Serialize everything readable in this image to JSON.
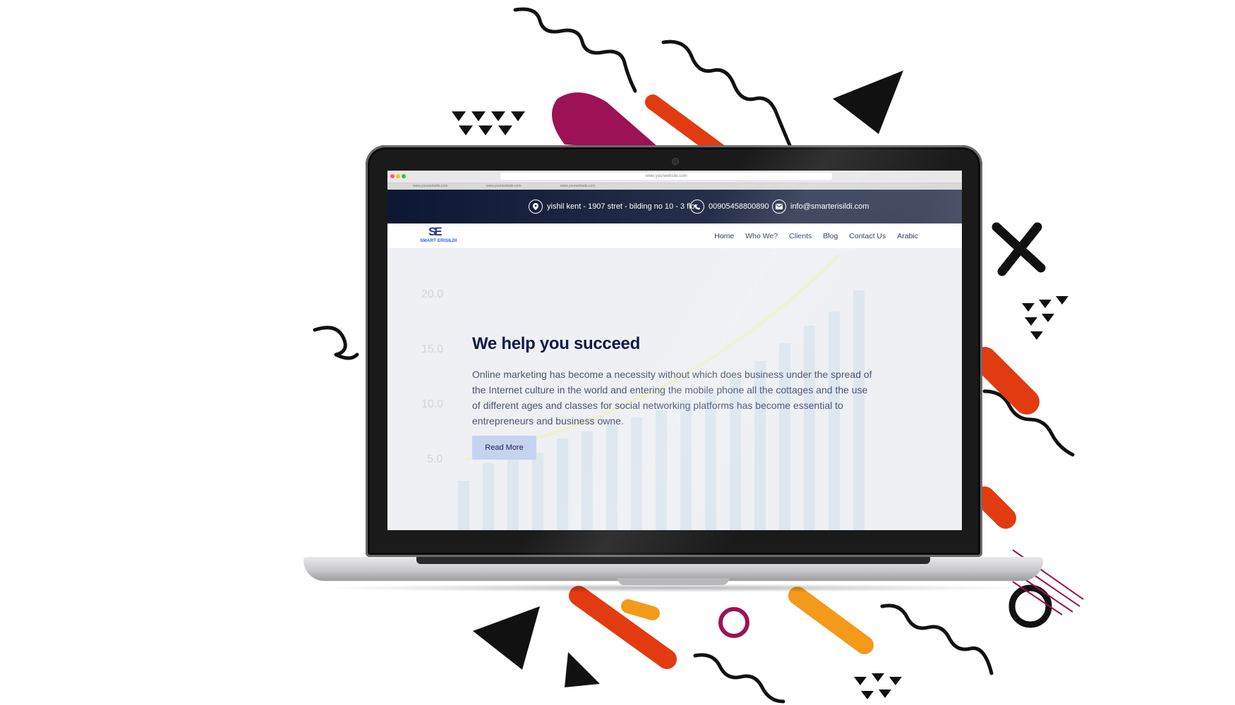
{
  "browser": {
    "url": "www.yourwebsite.com",
    "tabs": [
      "www.yourwebsite.com",
      "www.yourwebsite.com",
      "www.yourwebsite.com"
    ]
  },
  "topbar": {
    "address": "yishil kent - 1907 stret - bilding no 10 - 3 flor",
    "phone": "00905458800890",
    "email": "info@smarterisildi.com",
    "icons": [
      "map-pin-icon",
      "phone-icon",
      "envelope-icon"
    ]
  },
  "logo": {
    "monogram": "SE",
    "wordmark": "SMART ERISILDI"
  },
  "nav": {
    "items": [
      "Home",
      "Who We?",
      "Clients",
      "Blog",
      "Contact Us",
      "Arabic"
    ]
  },
  "hero": {
    "title": "We help you succeed",
    "text": "Online marketing has become a necessity without which does business under the spread of the Internet culture in the world and entering the mobile phone all the cottages and the use of different ages and classes for social networking platforms has become essential to entrepreneurs and business owne.",
    "button": "Read More",
    "background_tick_labels": [
      "20.0",
      "15.0",
      "10.0",
      "5.0"
    ]
  },
  "colors": {
    "topbar_dark": "#0c1733",
    "heading": "#0e1a4a",
    "button": "#c6d3f0",
    "decor_magenta": "#9c1254",
    "decor_orange": "#e23b12",
    "decor_yellow": "#f39a1a"
  }
}
